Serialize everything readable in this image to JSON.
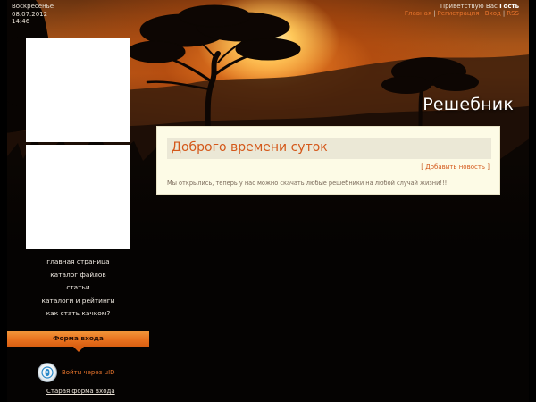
{
  "header": {
    "day": "Воскресенье",
    "date": "08.07.2012",
    "time": "14:46",
    "greeting_prefix": "Приветствую Вас",
    "greeting_user": "Гость",
    "top_links": [
      "Главная",
      "Регистрация",
      "Вход",
      "RSS"
    ],
    "top_link_separator": "|",
    "site_title": "Решебник"
  },
  "sidebar": {
    "nav_items": [
      "главная страница",
      "каталог файлов",
      "статьи",
      "каталоги и рейтинги",
      "как стать качком?"
    ],
    "login": {
      "title": "Форма входа",
      "uid_label": "Войти через uID",
      "old_form_label": "Старая форма входа"
    }
  },
  "main": {
    "title": "Доброго времени суток",
    "add_news_label": "Добавить новость",
    "bracket_open": "[",
    "bracket_close": "]",
    "body_text": "Мы открылись, теперь у нас можно скачать любые решебники на любой случай жизни!!!"
  },
  "colors": {
    "accent": "#e8742c",
    "title": "#d4581a",
    "panel_bg": "#fdfbe6",
    "login_bar": "#e9731f"
  }
}
